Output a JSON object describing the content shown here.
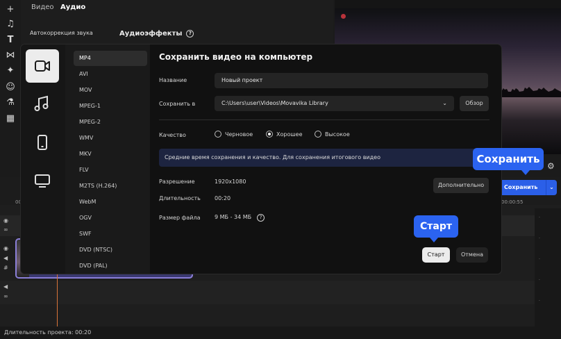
{
  "top_panel": {
    "tabs": [
      "Видео",
      "Аудио"
    ],
    "auto_correction": "Автокоррекция звука",
    "audio_effects": "Аудиоэффекты"
  },
  "timeline": {
    "time_00": "00",
    "time_end": "00:00:55",
    "duration_status": "Длительность проекта: 00:20"
  },
  "main_save_button": "Сохранить",
  "modal": {
    "title": "Сохранить видео на компьютер",
    "categories": [
      "video-camera-icon",
      "music-note-icon",
      "phone-icon",
      "monitor-icon"
    ],
    "formats": [
      "MP4",
      "AVI",
      "MOV",
      "MPEG-1",
      "MPEG-2",
      "WMV",
      "MKV",
      "FLV",
      "M2TS (H.264)",
      "WebM",
      "OGV",
      "SWF",
      "DVD (NTSC)",
      "DVD (PAL)"
    ],
    "selected_format": "MP4",
    "name_label": "Название",
    "name_value": "Новый проект",
    "save_in_label": "Сохранить в",
    "save_in_value": "C:\\Users\\user\\Videos\\Movavika Library",
    "browse_button": "Обзор",
    "quality_label": "Качество",
    "quality_options": [
      "Черновое",
      "Хорошее",
      "Высокое"
    ],
    "quality_selected": "Хорошее",
    "info_text": "Средние время сохранения и качество. Для сохранения итогового видео",
    "resolution_label": "Разрешение",
    "resolution_value": "1920x1080",
    "more_button": "Дополнительно",
    "duration_label": "Длительность",
    "duration_value": "00:20",
    "filesize_label": "Размер файла",
    "filesize_value": "9 МБ - 34 МБ",
    "start_button": "Старт",
    "cancel_button": "Отмена"
  },
  "tooltips": {
    "save": "Сохранить",
    "start": "Старт"
  },
  "colors": {
    "accent": "#2b63f0",
    "modal_bg": "#111111",
    "info_bg": "#1d2440"
  }
}
